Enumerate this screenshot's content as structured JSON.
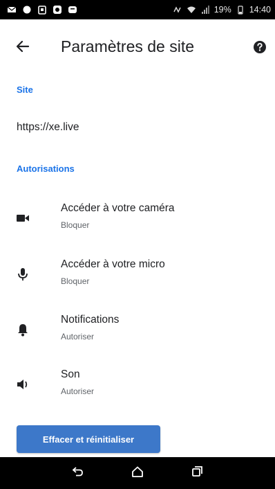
{
  "status_bar": {
    "battery_percent": "19%",
    "time": "14:40",
    "left_icons": [
      "mail-icon",
      "record-icon",
      "clipboard-icon",
      "app-icon",
      "message-icon"
    ],
    "right_icons": [
      "nfc-icon",
      "wifi-icon",
      "signal-icon",
      "battery-icon"
    ]
  },
  "toolbar": {
    "back_icon": "arrow-back-icon",
    "title": "Paramètres de site",
    "help_icon": "help-icon"
  },
  "sections": {
    "site_header": "Site",
    "site_url": "https://xe.live",
    "permissions_header": "Autorisations"
  },
  "permissions": [
    {
      "icon": "camera-icon",
      "title": "Accéder à votre caméra",
      "status": "Bloquer"
    },
    {
      "icon": "microphone-icon",
      "title": "Accéder à votre micro",
      "status": "Bloquer"
    },
    {
      "icon": "bell-icon",
      "title": "Notifications",
      "status": "Autoriser"
    },
    {
      "icon": "speaker-icon",
      "title": "Son",
      "status": "Autoriser"
    }
  ],
  "actions": {
    "reset_label": "Effacer et réinitialiser"
  },
  "nav_bar": {
    "items": [
      "back-nav-icon",
      "home-nav-icon",
      "recents-nav-icon"
    ]
  },
  "colors": {
    "accent": "#1a73e8",
    "button": "#3d78c9",
    "text_primary": "#202124",
    "text_secondary": "#5f6368",
    "bars": "#000000"
  }
}
